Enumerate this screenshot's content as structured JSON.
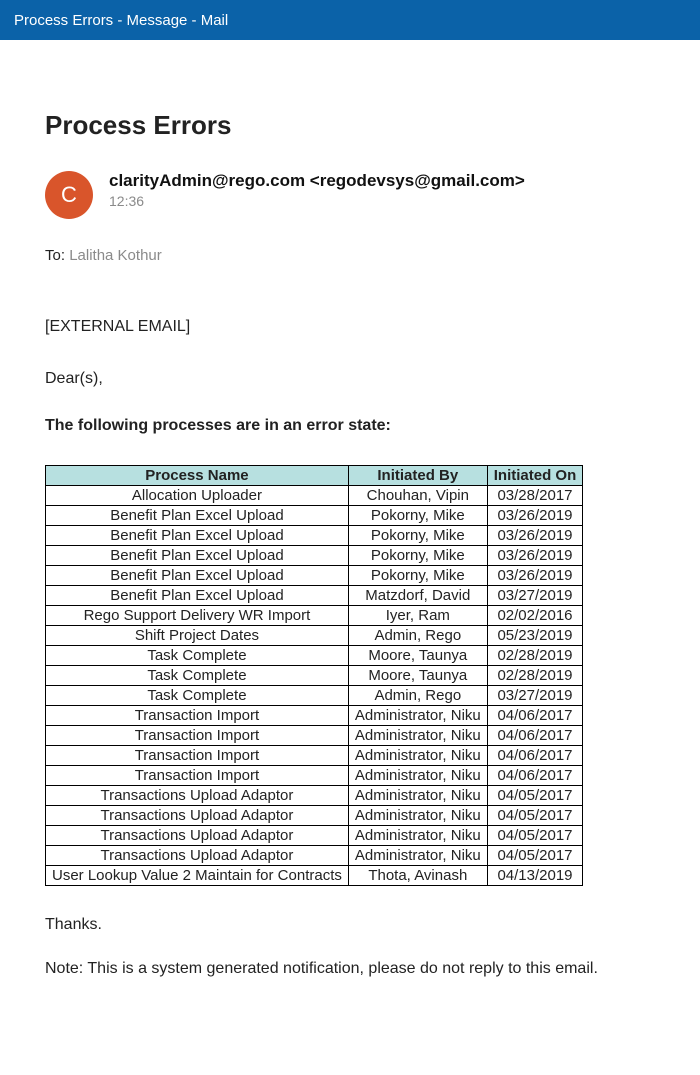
{
  "window": {
    "title": "Process Errors - Message - Mail"
  },
  "page": {
    "title": "Process Errors"
  },
  "sender": {
    "avatar_initial": "C",
    "display": "clarityAdmin@rego.com <regodevsys@gmail.com>",
    "time": "12:36"
  },
  "recipient": {
    "label": "To:",
    "name": "Lalitha Kothur"
  },
  "body": {
    "external_tag": "[EXTERNAL EMAIL]",
    "salutation": "Dear(s),",
    "table_intro": "The following processes are in an error state:",
    "thanks": "Thanks.",
    "note": "Note: This is a system generated notification, please do not reply to this email."
  },
  "table": {
    "headers": {
      "c0": "Process Name",
      "c1": "Initiated By",
      "c2": "Initiated On"
    },
    "rows": [
      {
        "process": "Allocation Uploader",
        "by": "Chouhan, Vipin",
        "on": "03/28/2017"
      },
      {
        "process": "Benefit Plan Excel Upload",
        "by": "Pokorny, Mike",
        "on": "03/26/2019"
      },
      {
        "process": "Benefit Plan Excel Upload",
        "by": "Pokorny, Mike",
        "on": "03/26/2019"
      },
      {
        "process": "Benefit Plan Excel Upload",
        "by": "Pokorny, Mike",
        "on": "03/26/2019"
      },
      {
        "process": "Benefit Plan Excel Upload",
        "by": "Pokorny, Mike",
        "on": "03/26/2019"
      },
      {
        "process": "Benefit Plan Excel Upload",
        "by": "Matzdorf, David",
        "on": "03/27/2019"
      },
      {
        "process": "Rego Support Delivery WR Import",
        "by": "Iyer, Ram",
        "on": "02/02/2016"
      },
      {
        "process": "Shift Project Dates",
        "by": "Admin, Rego",
        "on": "05/23/2019"
      },
      {
        "process": "Task Complete",
        "by": "Moore, Taunya",
        "on": "02/28/2019"
      },
      {
        "process": "Task Complete",
        "by": "Moore, Taunya",
        "on": "02/28/2019"
      },
      {
        "process": "Task Complete",
        "by": "Admin, Rego",
        "on": "03/27/2019"
      },
      {
        "process": "Transaction Import",
        "by": "Administrator, Niku",
        "on": "04/06/2017"
      },
      {
        "process": "Transaction Import",
        "by": "Administrator, Niku",
        "on": "04/06/2017"
      },
      {
        "process": "Transaction Import",
        "by": "Administrator, Niku",
        "on": "04/06/2017"
      },
      {
        "process": "Transaction Import",
        "by": "Administrator, Niku",
        "on": "04/06/2017"
      },
      {
        "process": "Transactions Upload Adaptor",
        "by": "Administrator, Niku",
        "on": "04/05/2017"
      },
      {
        "process": "Transactions Upload Adaptor",
        "by": "Administrator, Niku",
        "on": "04/05/2017"
      },
      {
        "process": "Transactions Upload Adaptor",
        "by": "Administrator, Niku",
        "on": "04/05/2017"
      },
      {
        "process": "Transactions Upload Adaptor",
        "by": "Administrator, Niku",
        "on": "04/05/2017"
      },
      {
        "process": "User Lookup Value 2 Maintain for Contracts",
        "by": "Thota, Avinash",
        "on": "04/13/2019"
      }
    ]
  }
}
